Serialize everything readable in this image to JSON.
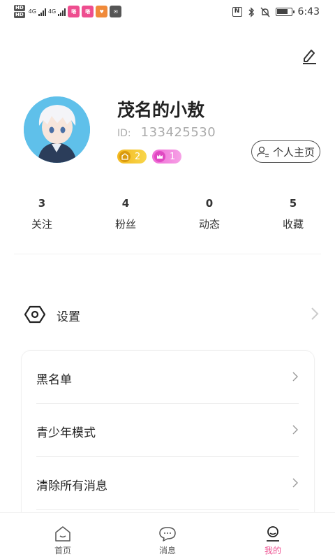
{
  "status_bar": {
    "network_badges": [
      "HD",
      "HD"
    ],
    "network_types": [
      "4G",
      "4G"
    ],
    "app_badges": [
      {
        "label": "嗒",
        "color": "#ee4d8f"
      },
      {
        "label": "嗒",
        "color": "#ee4d8f"
      },
      {
        "label": "♥",
        "color": "#f08a3a"
      },
      {
        "label": "✉",
        "color": "#555555"
      }
    ],
    "time": "6:43",
    "icons": [
      "nfc-icon",
      "bluetooth-icon",
      "mute-icon",
      "battery-icon"
    ]
  },
  "profile": {
    "username": "茂名的小敖",
    "id_label": "ID:",
    "id_value": "133425530",
    "level_badge": "2",
    "vip_badge": "1",
    "homepage_button": "个人主页"
  },
  "stats": [
    {
      "count": "3",
      "label": "关注"
    },
    {
      "count": "4",
      "label": "粉丝"
    },
    {
      "count": "0",
      "label": "动态"
    },
    {
      "count": "5",
      "label": "收藏"
    }
  ],
  "settings": {
    "label": "设置"
  },
  "menu": {
    "items": [
      {
        "label": "黑名单"
      },
      {
        "label": "青少年模式"
      },
      {
        "label": "清除所有消息"
      }
    ]
  },
  "bottom_nav": {
    "items": [
      {
        "label": "首页",
        "icon": "home-icon"
      },
      {
        "label": "消息",
        "icon": "message-icon"
      },
      {
        "label": "我的",
        "icon": "profile-icon"
      }
    ],
    "active_color": "#ee4d8f"
  }
}
